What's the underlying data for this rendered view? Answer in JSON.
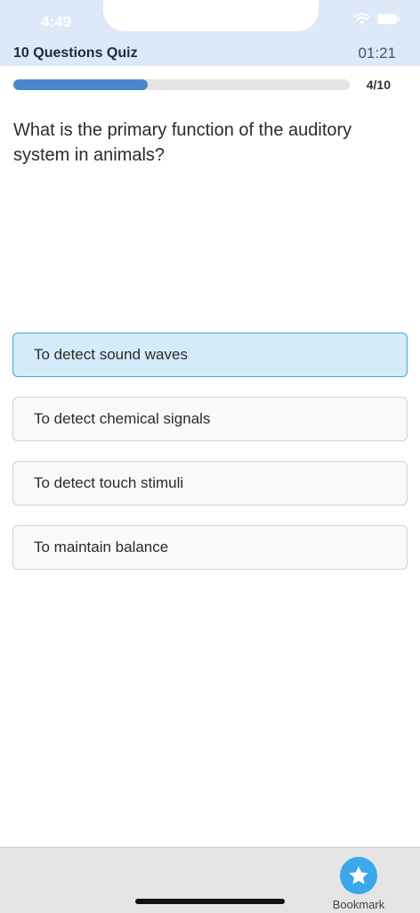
{
  "status_bar": {
    "time": "4:49"
  },
  "header": {
    "title": "10 Questions Quiz",
    "timer": "01:21"
  },
  "progress": {
    "fraction": 0.4,
    "label": "4/10"
  },
  "question": {
    "text": "What is the primary function of the auditory system in animals?"
  },
  "options": [
    {
      "label": "To detect sound waves",
      "selected": true
    },
    {
      "label": "To detect chemical signals",
      "selected": false
    },
    {
      "label": "To detect touch stimuli",
      "selected": false
    },
    {
      "label": "To maintain balance",
      "selected": false
    }
  ],
  "bottom_bar": {
    "bookmark_label": "Bookmark",
    "bookmark_icon": "star-icon"
  },
  "colors": {
    "accent": "#3aa8ea",
    "progress": "#4a86cc",
    "header_bg": "#dde9f8",
    "selected_bg": "#d4ecfa"
  }
}
